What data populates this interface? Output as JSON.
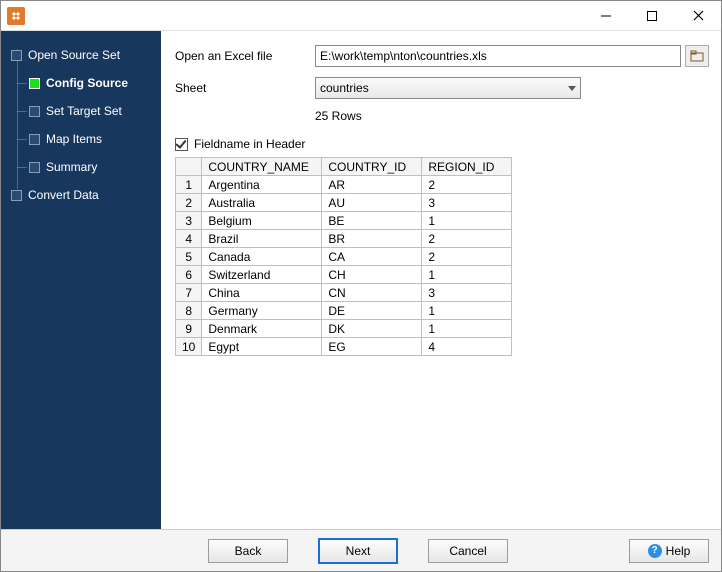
{
  "sidebar": {
    "items": [
      {
        "label": "Open Source Set",
        "active": false,
        "child": false
      },
      {
        "label": "Config Source",
        "active": true,
        "child": true
      },
      {
        "label": "Set Target Set",
        "active": false,
        "child": true
      },
      {
        "label": "Map Items",
        "active": false,
        "child": true
      },
      {
        "label": "Summary",
        "active": false,
        "child": true
      },
      {
        "label": "Convert Data",
        "active": false,
        "child": false
      }
    ]
  },
  "form": {
    "open_label": "Open an Excel file",
    "path_value": "E:\\work\\temp\\nton\\countries.xls",
    "sheet_label": "Sheet",
    "sheet_value": "countries",
    "rows_text": "25 Rows",
    "fieldname_label": "Fieldname in Header",
    "fieldname_checked": true
  },
  "table": {
    "headers": [
      "COUNTRY_NAME",
      "COUNTRY_ID",
      "REGION_ID"
    ],
    "rows": [
      [
        "Argentina",
        "AR",
        "2"
      ],
      [
        "Australia",
        "AU",
        "3"
      ],
      [
        "Belgium",
        "BE",
        "1"
      ],
      [
        "Brazil",
        "BR",
        "2"
      ],
      [
        "Canada",
        "CA",
        "2"
      ],
      [
        "Switzerland",
        "CH",
        "1"
      ],
      [
        "China",
        "CN",
        "3"
      ],
      [
        "Germany",
        "DE",
        "1"
      ],
      [
        "Denmark",
        "DK",
        "1"
      ],
      [
        "Egypt",
        "EG",
        "4"
      ]
    ]
  },
  "buttons": {
    "back": "Back",
    "next": "Next",
    "cancel": "Cancel",
    "help": "Help"
  }
}
